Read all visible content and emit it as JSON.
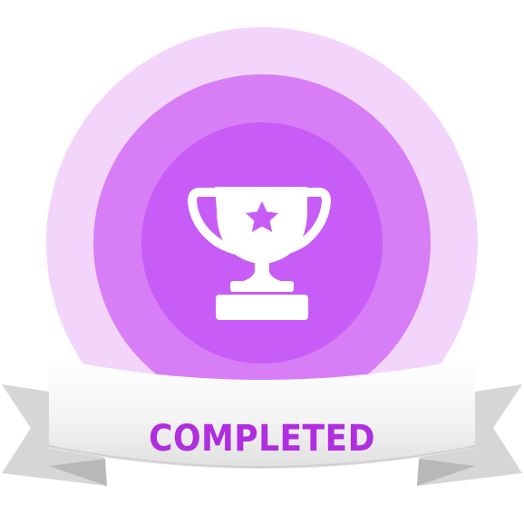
{
  "badge": {
    "label": "COMPLETED",
    "icon": "trophy-with-star-icon",
    "colors": {
      "outer_ring": "#f3d5fb",
      "middle_ring": "#d77ef7",
      "inner_circle": "#c85cf6",
      "trophy": "#ffffff",
      "ribbon": "#f5f5f5",
      "ribbon_shade": "#d6d6d6",
      "ribbon_fold": "#b8b8b8",
      "label": "#b02de0"
    }
  }
}
